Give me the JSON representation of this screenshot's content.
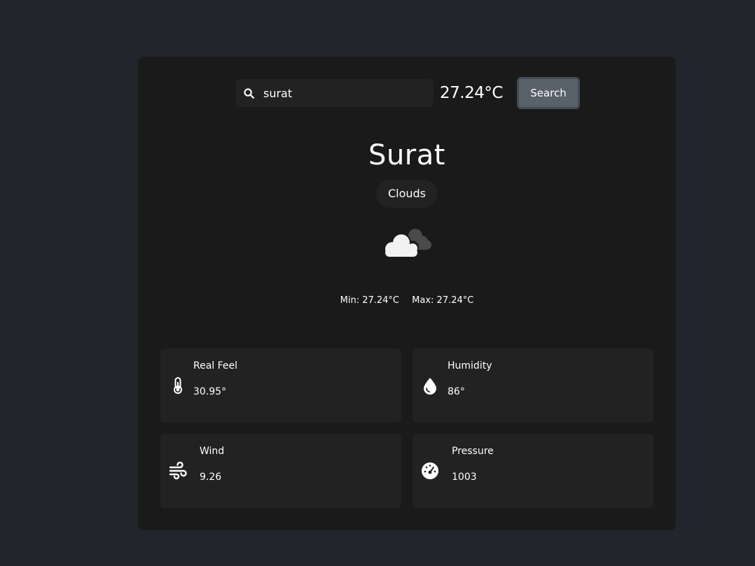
{
  "search": {
    "value": "surat",
    "temperature": "27.24°C",
    "button_label": "Search"
  },
  "weather": {
    "city": "Surat",
    "condition": "Clouds",
    "icon": "clouds-icon",
    "min": "Min: 27.24°C",
    "max": "Max: 27.24°C"
  },
  "details": [
    {
      "label": "Real Feel",
      "value": "30.95°",
      "icon": "thermometer-icon"
    },
    {
      "label": "Humidity",
      "value": "86°",
      "icon": "water-drop-icon"
    },
    {
      "label": "Wind",
      "value": "9.26",
      "icon": "wind-icon"
    },
    {
      "label": "Pressure",
      "value": "1003",
      "icon": "gauge-icon"
    }
  ]
}
